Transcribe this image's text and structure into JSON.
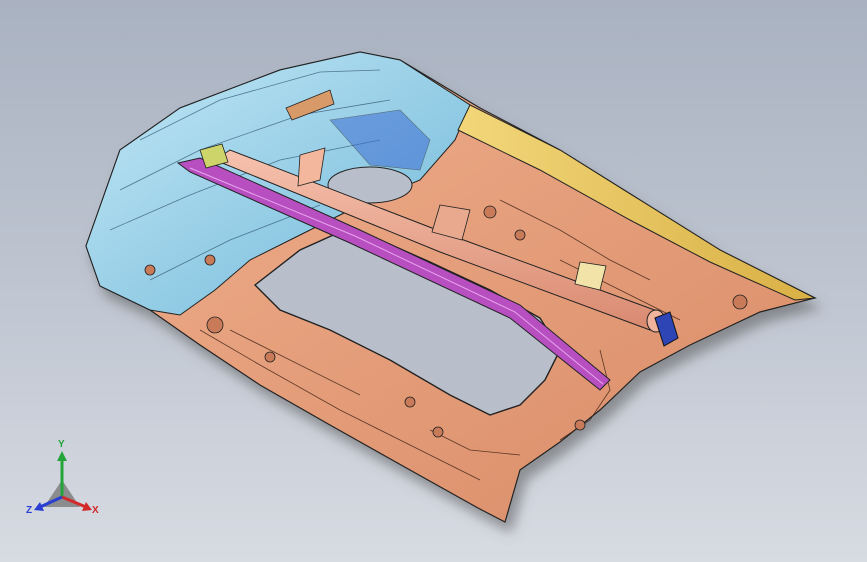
{
  "viewport": {
    "background_top": "#a9b2c1",
    "background_bottom": "#d7dbe2"
  },
  "model": {
    "colors": {
      "inner_panel": "#e9a07c",
      "side_panel": "#96cfe6",
      "rear_strip": "#e4c35a",
      "cross_brace": "#b84fc0",
      "hinge_bracket": "#2e45b5",
      "edges": "#222222"
    }
  },
  "triad": {
    "y_label": "Y",
    "x_label": "X",
    "z_label": "Z",
    "colors": {
      "x": "#d22a2a",
      "y": "#23a53a",
      "z": "#2a3fd2"
    }
  }
}
